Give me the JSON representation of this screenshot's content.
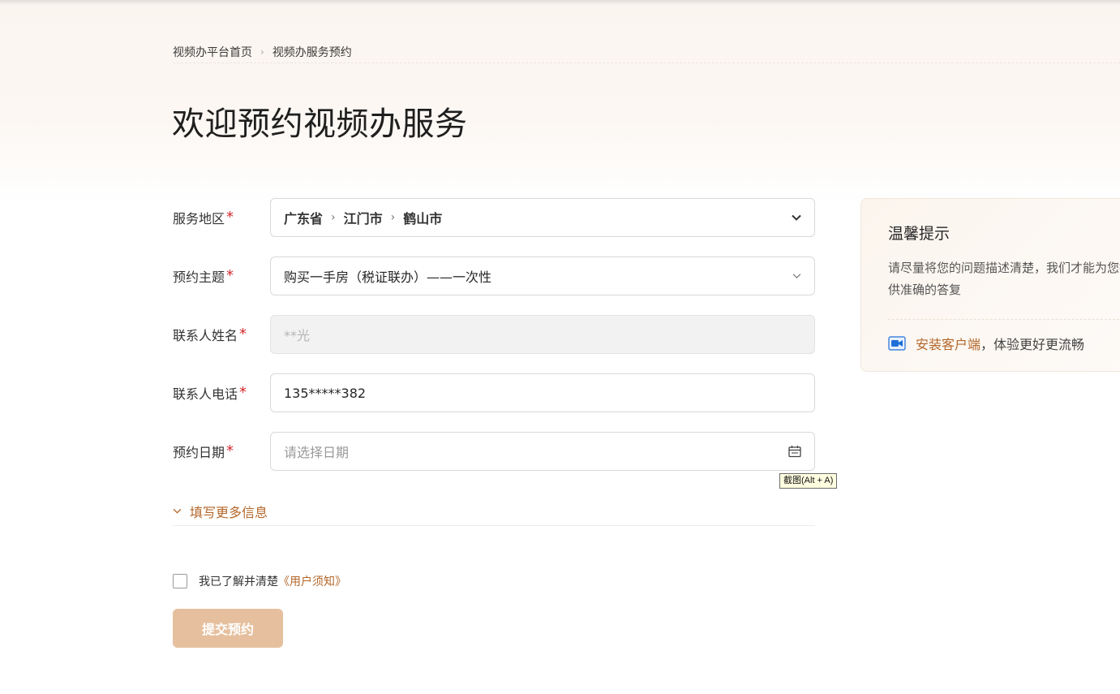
{
  "breadcrumb": {
    "home": "视频办平台首页",
    "separator": "›",
    "current": "视频办服务预约"
  },
  "page_title": "欢迎预约视频办服务",
  "form": {
    "region": {
      "label": "服务地区",
      "required_mark": "*",
      "province": "广东省",
      "city": "江门市",
      "district": "鹤山市",
      "sep": "›",
      "icon": "chevron-down-icon"
    },
    "topic": {
      "label": "预约主题",
      "required_mark": "*",
      "value": "购买一手房（税证联办）——一次性",
      "icon": "chevron-down-icon"
    },
    "contact_name": {
      "label": "联系人姓名",
      "required_mark": "*",
      "value": "**光",
      "disabled": true
    },
    "contact_phone": {
      "label": "联系人电话",
      "required_mark": "*",
      "value": "135*****382"
    },
    "date": {
      "label": "预约日期",
      "required_mark": "*",
      "placeholder": "请选择日期",
      "icon": "calendar-icon"
    }
  },
  "tooltip": "截图(Alt + A)",
  "more_info": {
    "label": "填写更多信息",
    "icon": "chevron-down-icon"
  },
  "agreement": {
    "prefix": "我已了解并清楚",
    "link": "《用户须知》"
  },
  "submit_label": "提交预约",
  "tip_card": {
    "title": "温馨提示",
    "body": "请尽量将您的问题描述清楚，我们才能为您提供准确的答复",
    "install_link": "安装客户端",
    "install_suffix": "，体验更好更流畅",
    "icon": "video-camera-icon"
  },
  "colors": {
    "accent": "#b4672a",
    "required": "#d4282d",
    "submit_disabled": "#e6c09e",
    "icon_blue": "#1f6fd8"
  }
}
